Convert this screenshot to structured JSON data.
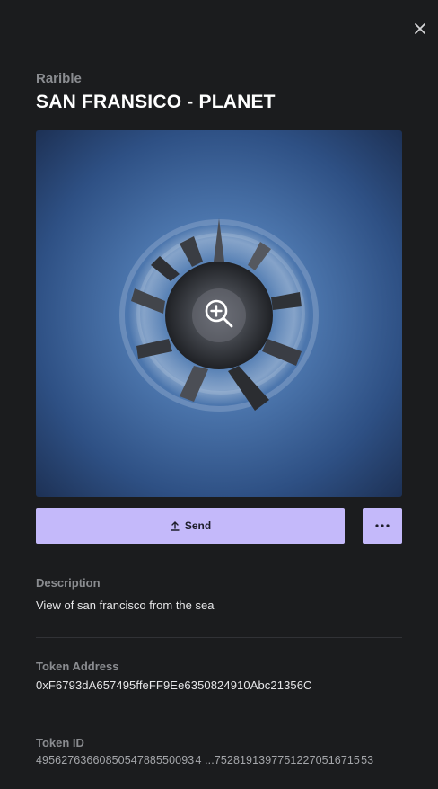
{
  "header": {
    "close_icon": "close-icon"
  },
  "asset": {
    "collection": "Rarible",
    "title": "SAN FRANSICO - PLANET",
    "zoom_icon": "zoom-in-icon"
  },
  "actions": {
    "send_label": "Send",
    "send_icon": "upload-arrow-icon",
    "more_icon": "ellipsis-icon"
  },
  "details": {
    "description_label": "Description",
    "description_value": "View of san francisco from the sea",
    "token_address_label": "Token Address",
    "token_address_value": "0xF6793dA657495ffeFF9Ee6350824910Abc21356C",
    "token_id_label": "Token ID",
    "token_id_value": "4956276366085054788550093 4 ...75281913977512270516715 53"
  },
  "colors": {
    "background": "#1b1c1e",
    "accent": "#c4b9fa",
    "muted_text": "#8a8c90"
  }
}
